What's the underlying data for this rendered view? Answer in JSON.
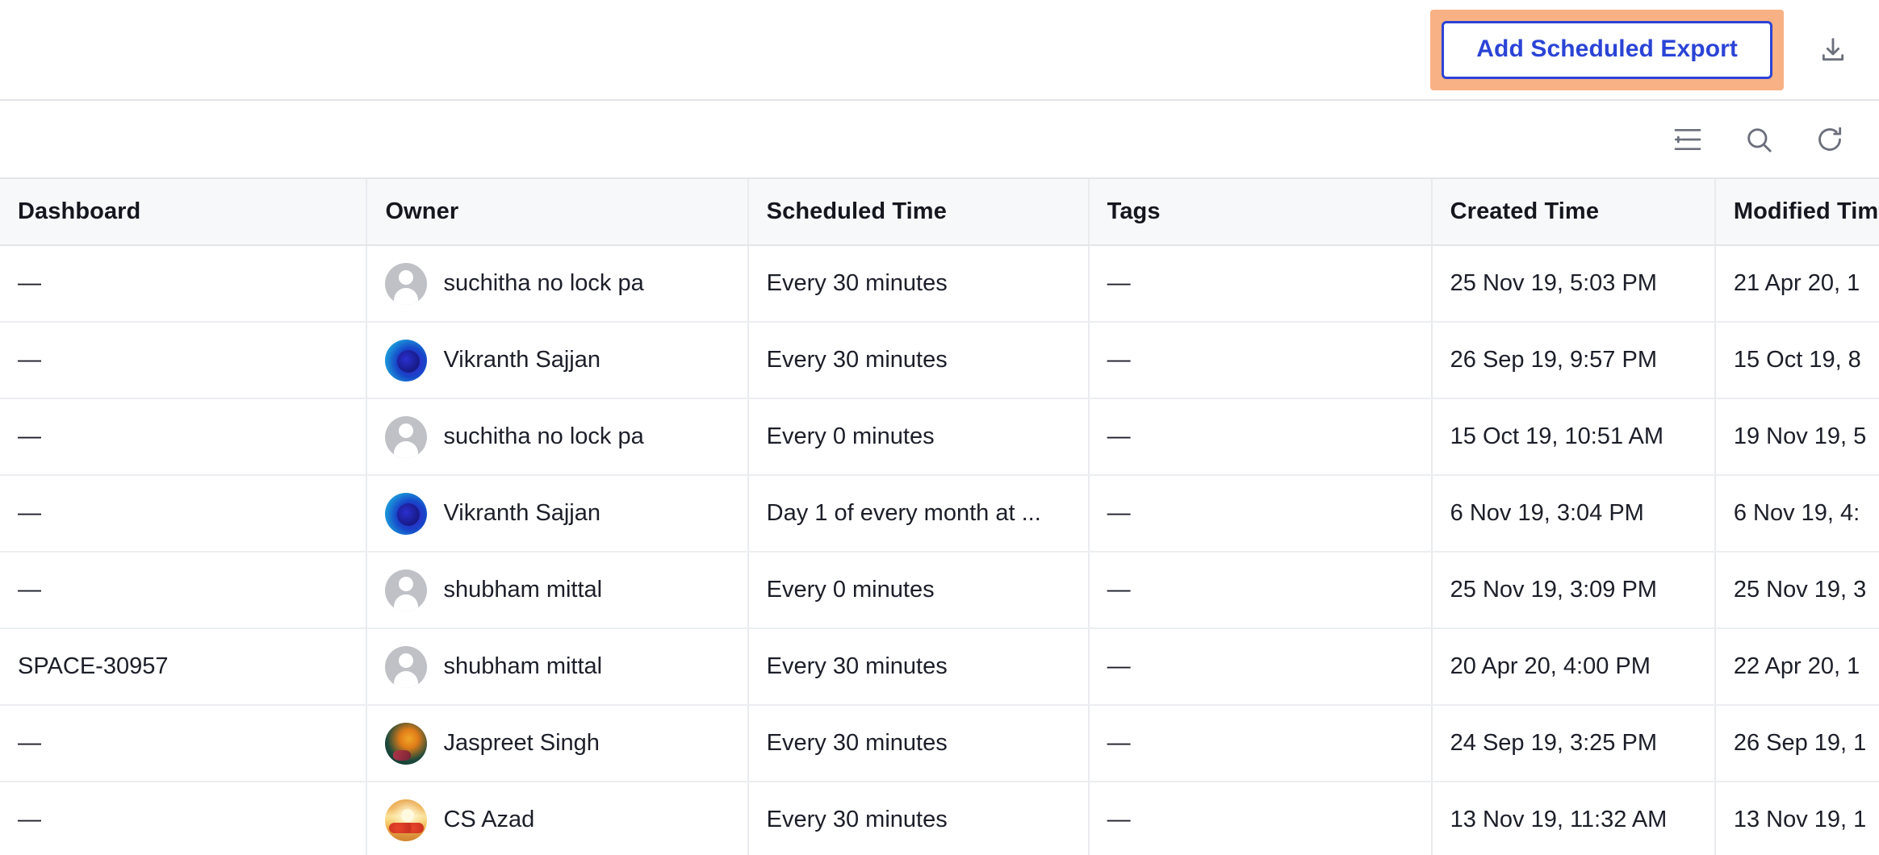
{
  "topbar": {
    "add_export_label": "Add Scheduled Export",
    "download_icon": "download-icon",
    "highlight_color": "#f8b184",
    "accent_color": "#2b44d6"
  },
  "toolbar": {
    "icons": [
      {
        "name": "add-filter-icon",
        "label": "Add filter"
      },
      {
        "name": "search-icon",
        "label": "Search"
      },
      {
        "name": "refresh-icon",
        "label": "Refresh"
      }
    ]
  },
  "table": {
    "columns": [
      {
        "key": "dashboard",
        "label": "Dashboard"
      },
      {
        "key": "owner",
        "label": "Owner"
      },
      {
        "key": "scheduled_time",
        "label": "Scheduled Time"
      },
      {
        "key": "tags",
        "label": "Tags"
      },
      {
        "key": "created_time",
        "label": "Created Time"
      },
      {
        "key": "modified_time",
        "label": "Modified Time"
      }
    ],
    "rows": [
      {
        "dashboard": "—",
        "owner": "suchitha no lock pa",
        "avatar": "placeholder",
        "scheduled_time": "Every 30 minutes",
        "tags": "—",
        "created_time": "25 Nov 19, 5:03 PM",
        "modified_time": "21 Apr 20, 1"
      },
      {
        "dashboard": "—",
        "owner": "Vikranth Sajjan",
        "avatar": "rose",
        "scheduled_time": "Every 30 minutes",
        "tags": "—",
        "created_time": "26 Sep 19, 9:57 PM",
        "modified_time": "15 Oct 19, 8"
      },
      {
        "dashboard": "—",
        "owner": "suchitha no lock pa",
        "avatar": "placeholder",
        "scheduled_time": "Every 0 minutes",
        "tags": "—",
        "created_time": "15 Oct 19, 10:51 AM",
        "modified_time": "19 Nov 19, 5"
      },
      {
        "dashboard": "—",
        "owner": "Vikranth Sajjan",
        "avatar": "rose",
        "scheduled_time": "Day 1 of every month at ...",
        "tags": "—",
        "created_time": "6 Nov 19, 3:04 PM",
        "modified_time": "6 Nov 19, 4:"
      },
      {
        "dashboard": "—",
        "owner": "shubham mittal",
        "avatar": "placeholder",
        "scheduled_time": "Every 0 minutes",
        "tags": "—",
        "created_time": "25 Nov 19, 3:09 PM",
        "modified_time": "25 Nov 19, 3"
      },
      {
        "dashboard": "SPACE-30957",
        "owner": "shubham mittal",
        "avatar": "placeholder",
        "scheduled_time": "Every 30 minutes",
        "tags": "—",
        "created_time": "20 Apr 20, 4:00 PM",
        "modified_time": "22 Apr 20, 1"
      },
      {
        "dashboard": "—",
        "owner": "Jaspreet Singh",
        "avatar": "jaspreet",
        "scheduled_time": "Every 30 minutes",
        "tags": "—",
        "created_time": "24 Sep 19, 3:25 PM",
        "modified_time": "26 Sep 19, 1"
      },
      {
        "dashboard": "—",
        "owner": "CS Azad",
        "avatar": "sunset",
        "scheduled_time": "Every 30 minutes",
        "tags": "—",
        "created_time": "13 Nov 19, 11:32 AM",
        "modified_time": "13 Nov 19, 1"
      }
    ]
  }
}
